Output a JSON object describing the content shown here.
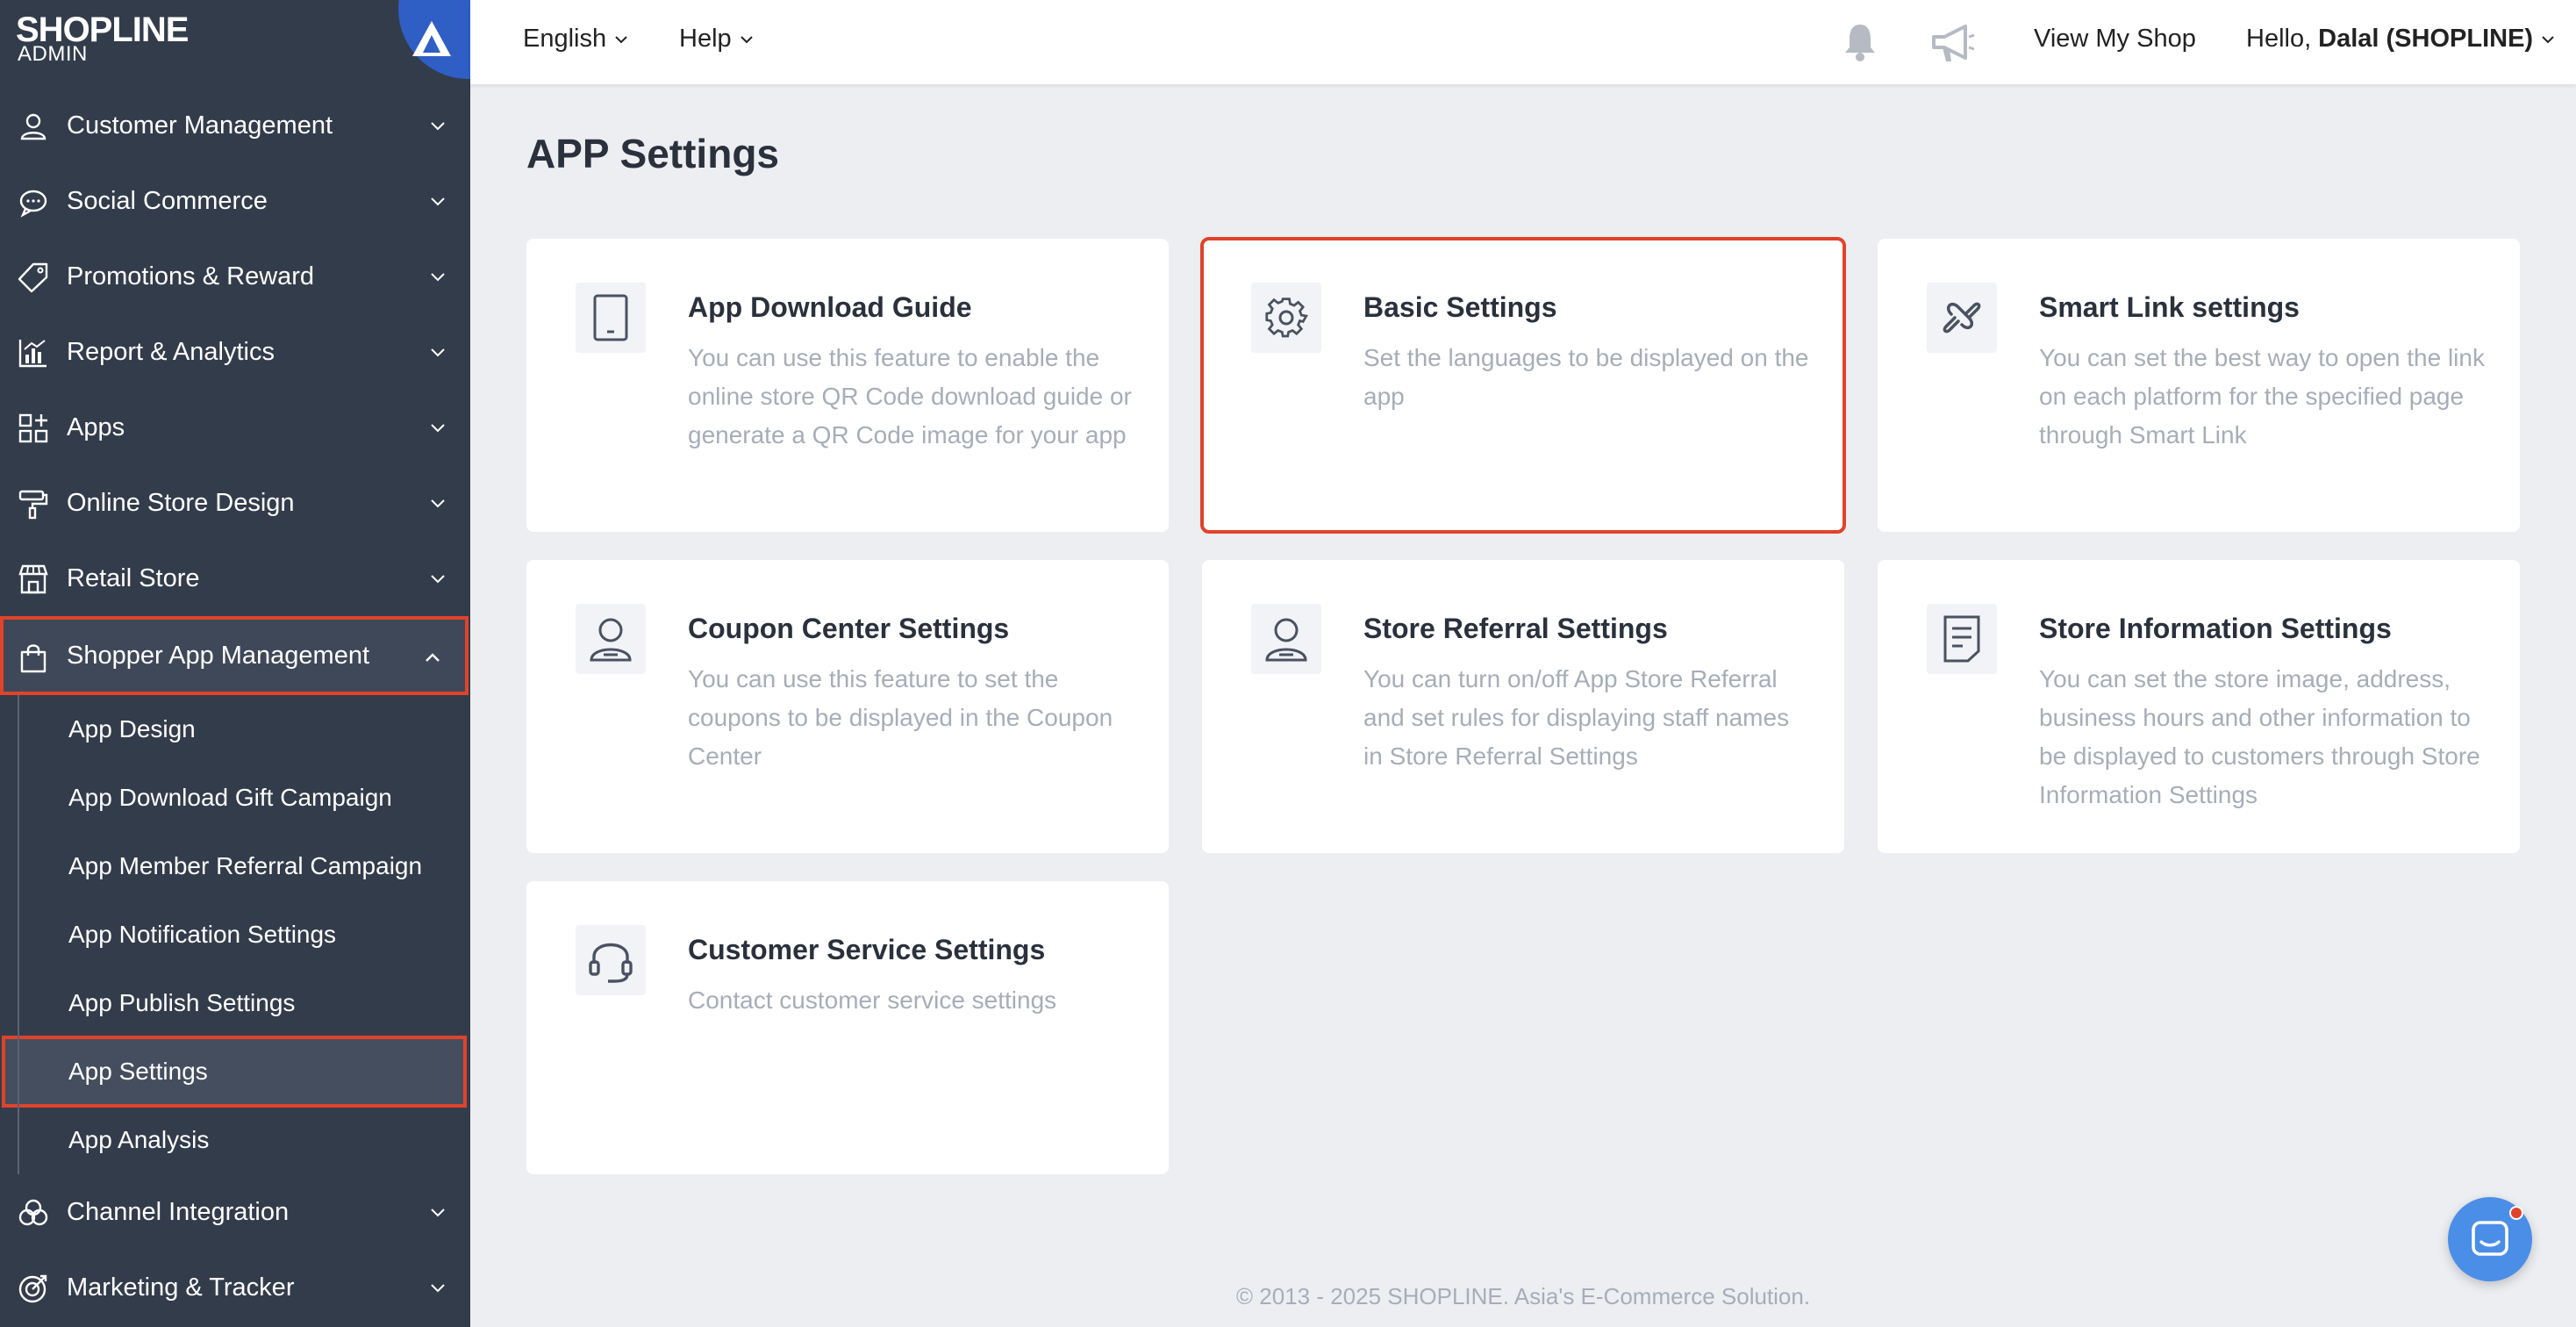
{
  "brand": {
    "logo": "SHOPLINE",
    "sub": "ADMIN"
  },
  "sidebar": {
    "items": [
      {
        "label": "Customer Management",
        "icon": "user-icon"
      },
      {
        "label": "Social Commerce",
        "icon": "chat-bubble-icon"
      },
      {
        "label": "Promotions & Reward",
        "icon": "tag-icon"
      },
      {
        "label": "Report & Analytics",
        "icon": "bar-chart-icon"
      },
      {
        "label": "Apps",
        "icon": "apps-grid-icon"
      },
      {
        "label": "Online Store Design",
        "icon": "paint-roller-icon"
      },
      {
        "label": "Retail Store",
        "icon": "store-icon"
      }
    ],
    "expanded": {
      "label": "Shopper App Management",
      "icon": "shopping-bag-icon"
    },
    "sub_items": [
      {
        "label": "App Design"
      },
      {
        "label": "App Download Gift Campaign"
      },
      {
        "label": "App Member Referral Campaign"
      },
      {
        "label": "App Notification Settings"
      },
      {
        "label": "App Publish Settings"
      },
      {
        "label": "App Settings"
      },
      {
        "label": "App Analysis"
      }
    ],
    "bottom_items": [
      {
        "label": "Channel Integration",
        "icon": "channel-circles-icon"
      },
      {
        "label": "Marketing & Tracker",
        "icon": "target-icon"
      }
    ]
  },
  "topbar": {
    "language": "English",
    "help": "Help",
    "view_shop": "View My Shop",
    "greeting": "Hello,",
    "user": "Dalal (SHOPLINE)"
  },
  "main": {
    "title": "APP Settings",
    "cards": [
      {
        "title": "App Download Guide",
        "desc": "You can use this feature to enable the online store QR Code download guide or generate a QR Code image for your app",
        "icon": "tablet-icon"
      },
      {
        "title": "Basic Settings",
        "desc": "Set the languages to be displayed on the app",
        "icon": "gear-icon"
      },
      {
        "title": "Smart Link settings",
        "desc": "You can set the best way to open the link on each platform for the specified page through Smart Link",
        "icon": "link-icon"
      },
      {
        "title": "Coupon Center Settings",
        "desc": "You can use this feature to set the coupons to be displayed in the Coupon Center",
        "icon": "person-icon"
      },
      {
        "title": "Store Referral Settings",
        "desc": "You can turn on/off App Store Referral and set rules for displaying staff names in Store Referral Settings",
        "icon": "person-icon"
      },
      {
        "title": "Store Information Settings",
        "desc": "You can set the store image, address, business hours and other information to be displayed to customers through Store Information Settings",
        "icon": "document-icon"
      },
      {
        "title": "Customer Service Settings",
        "desc": "Contact customer service settings",
        "icon": "headset-icon"
      }
    ]
  },
  "footer": "© 2013 - 2025  SHOPLINE. Asia's E-Commerce Solution.",
  "colors": {
    "sidebar": "#333c4b",
    "highlight": "#e0432a",
    "accent": "#2f5ec4",
    "chat": "#4a8ee8"
  }
}
